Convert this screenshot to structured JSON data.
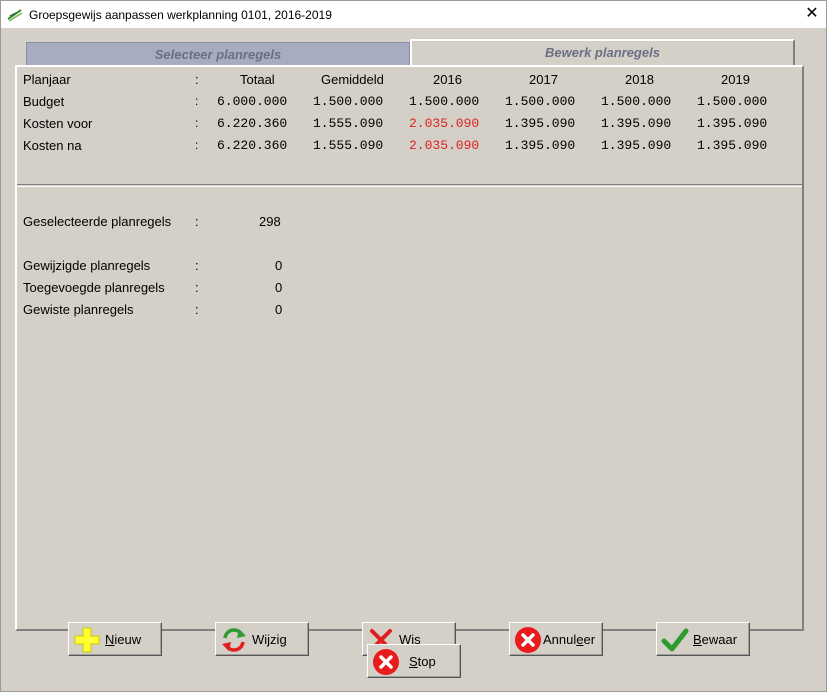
{
  "window": {
    "title": "Groepsgewijs aanpassen werkplanning 0101, 2016-2019",
    "close_glyph": "✕"
  },
  "tabs": [
    {
      "label": "Selecteer planregels",
      "active": false
    },
    {
      "label": "Bewerk planregels",
      "active": true
    }
  ],
  "table": {
    "header": {
      "label": "Planjaar",
      "colon": ":",
      "cols": [
        "Totaal",
        "Gemiddeld",
        "2016",
        "2017",
        "2018",
        "2019"
      ]
    },
    "rows": [
      {
        "label": "Budget",
        "colon": ":",
        "values": [
          "6.000.000",
          "1.500.000",
          "1.500.000",
          "1.500.000",
          "1.500.000",
          "1.500.000"
        ]
      },
      {
        "label": "Kosten voor",
        "colon": ":",
        "values": [
          "6.220.360",
          "1.555.090",
          "2.035.090",
          "1.395.090",
          "1.395.090",
          "1.395.090"
        ]
      },
      {
        "label": "Kosten na",
        "colon": ":",
        "values": [
          "6.220.360",
          "1.555.090",
          "2.035.090",
          "1.395.090",
          "1.395.090",
          "1.395.090"
        ]
      }
    ],
    "highlight_color": "#e02020"
  },
  "stats": [
    {
      "label": "Geselecteerde planregels",
      "colon": ":",
      "value": "298"
    },
    {
      "label": "Gewijzigde planregels",
      "colon": ":",
      "value": "0"
    },
    {
      "label": "Toegevoegde planregels",
      "colon": ":",
      "value": "0"
    },
    {
      "label": "Gewiste planregels",
      "colon": ":",
      "value": "0"
    }
  ],
  "buttons": {
    "nieuw": {
      "first": "N",
      "rest": "ieuw",
      "icon": "plus-icon"
    },
    "wijzig": {
      "pre": "Wijzi",
      "under": "g",
      "post": "",
      "icon": "refresh-icon"
    },
    "wis": {
      "first": "W",
      "rest": "is",
      "icon": "x-icon"
    },
    "annuleer": {
      "pre": "Annul",
      "under": "e",
      "post": "er",
      "icon": "cancel-icon"
    },
    "bewaar": {
      "first": "B",
      "rest": "ewaar",
      "icon": "check-icon"
    },
    "stop": {
      "first": "S",
      "rest": "top",
      "icon": "stop-icon"
    }
  }
}
